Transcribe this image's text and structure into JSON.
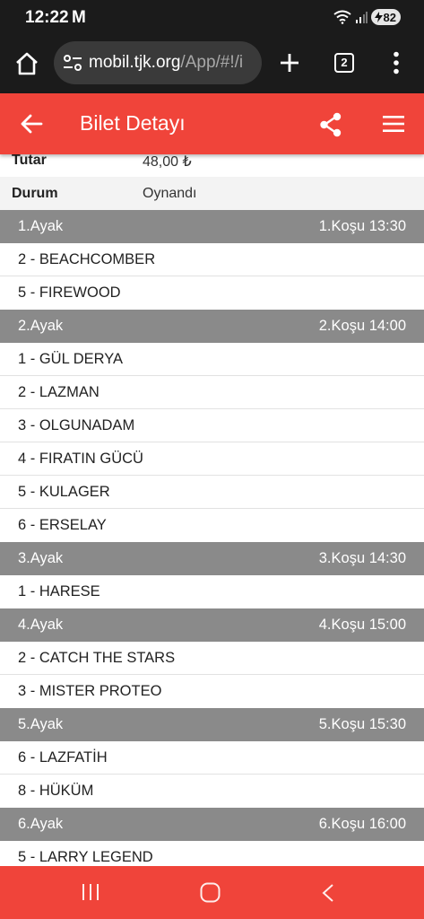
{
  "status_bar": {
    "time": "12:22",
    "notification_letter": "M",
    "battery": "82"
  },
  "browser": {
    "url_host": "mobil.tjk.org",
    "url_path": "/App/#!/i",
    "tab_count": "2"
  },
  "header": {
    "title": "Bilet Detayı"
  },
  "ticket_info": [
    {
      "label": "Tutar",
      "value": "48,00 ₺"
    },
    {
      "label": "Durum",
      "value": "Oynandı"
    }
  ],
  "legs": [
    {
      "name": "1.Ayak",
      "race": "1.Koşu 13:30",
      "horses": [
        "2 - BEACHCOMBER",
        "5 - FIREWOOD"
      ]
    },
    {
      "name": "2.Ayak",
      "race": "2.Koşu 14:00",
      "horses": [
        "1 - GÜL DERYA",
        "2 - LAZMAN",
        "3 - OLGUNADAM",
        "4 - FIRATIN GÜCÜ",
        "5 - KULAGER",
        "6 - ERSELAY"
      ]
    },
    {
      "name": "3.Ayak",
      "race": "3.Koşu 14:30",
      "horses": [
        "1 - HARESE"
      ]
    },
    {
      "name": "4.Ayak",
      "race": "4.Koşu 15:00",
      "horses": [
        "2 - CATCH THE STARS",
        "3 - MISTER PROTEO"
      ]
    },
    {
      "name": "5.Ayak",
      "race": "5.Koşu 15:30",
      "horses": [
        "6 - LAZFATİH",
        "8 - HÜKÜM"
      ]
    },
    {
      "name": "6.Ayak",
      "race": "6.Koşu 16:00",
      "horses": [
        "5 - LARRY LEGEND"
      ]
    }
  ],
  "colors": {
    "header_red": "#f0443a",
    "leg_header_gray": "#8a8a8a",
    "browser_dark": "#1b1b1b"
  }
}
